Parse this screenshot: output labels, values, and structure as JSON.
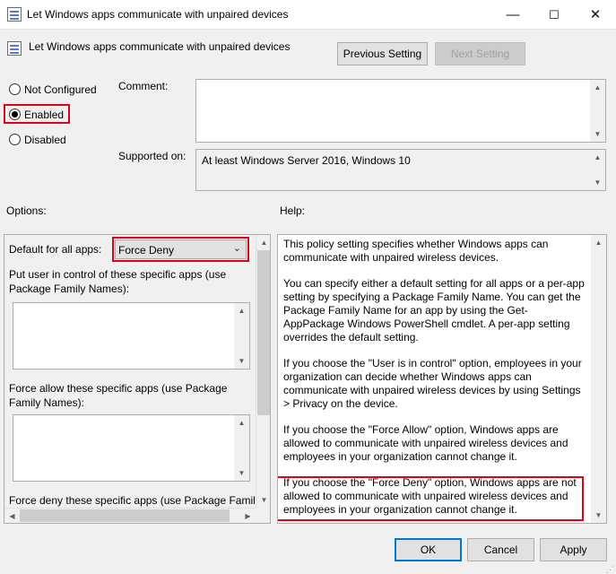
{
  "window": {
    "title": "Let Windows apps communicate with unpaired devices",
    "icon": "policy-icon",
    "controls": {
      "minimize": "—",
      "maximize": "☐",
      "close": "✕"
    }
  },
  "header": {
    "policy_name": "Let Windows apps communicate with unpaired devices",
    "previous_setting": "Previous Setting",
    "next_setting": "Next Setting"
  },
  "state": {
    "options": [
      "Not Configured",
      "Enabled",
      "Disabled"
    ],
    "selected": "Enabled"
  },
  "comment": {
    "label": "Comment:",
    "value": ""
  },
  "supported": {
    "label": "Supported on:",
    "value": "At least Windows Server 2016, Windows 10"
  },
  "options_panel": {
    "label": "Options:",
    "default_label": "Default for all apps:",
    "default_value": "Force Deny",
    "user_control_label": "Put user in control of these specific apps (use Package Family Names):",
    "force_allow_label": "Force allow these specific apps (use Package Family Names):",
    "force_deny_label": "Force deny these specific apps (use Package Family"
  },
  "help": {
    "label": "Help:",
    "paragraphs": [
      "This policy setting specifies whether Windows apps can communicate with unpaired wireless devices.",
      "You can specify either a default setting for all apps or a per-app setting by specifying a Package Family Name. You can get the Package Family Name for an app by using the Get-AppPackage Windows PowerShell cmdlet. A per-app setting overrides the default setting.",
      "If you choose the \"User is in control\" option, employees in your organization can decide whether Windows apps can communicate with unpaired wireless devices by using Settings > Privacy on the device.",
      "If you choose the \"Force Allow\" option, Windows apps are allowed to communicate with unpaired wireless devices and employees in your organization cannot change it.",
      "If you choose the \"Force Deny\" option, Windows apps are not allowed to communicate with unpaired wireless devices and employees in your organization cannot change it."
    ]
  },
  "footer": {
    "ok": "OK",
    "cancel": "Cancel",
    "apply": "Apply"
  },
  "colors": {
    "highlight": "#e0001b",
    "accent": "#0078d7"
  }
}
